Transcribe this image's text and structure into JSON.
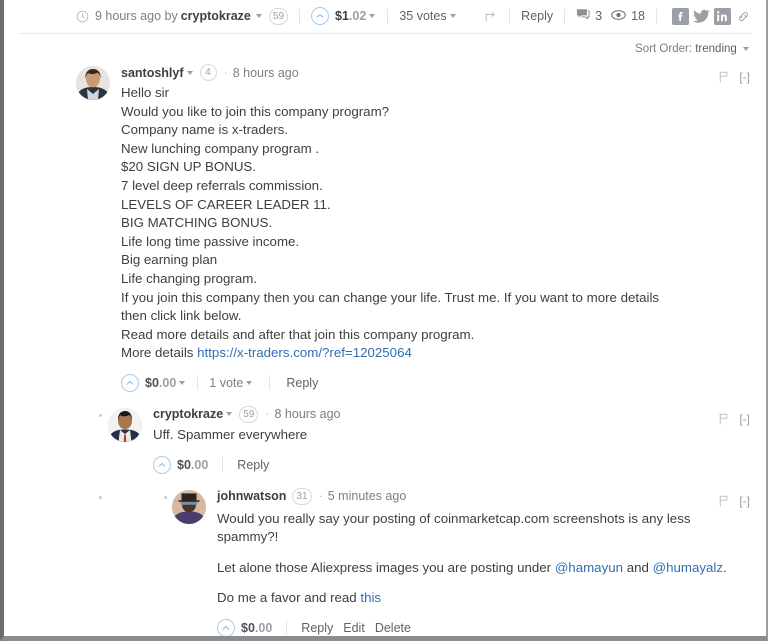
{
  "post_meta": {
    "clock_icon": "clock-icon",
    "time_prefix": "9 hours ago by",
    "author": "cryptokraze",
    "author_reputation": "59",
    "payout_dollars": "$1",
    "payout_cents": ".02",
    "votes": "35 votes",
    "share_icon": "share-icon",
    "reply_label": "Reply",
    "comment_count": "3",
    "view_count": "18",
    "social": [
      "facebook-icon",
      "twitter-icon",
      "linkedin-icon",
      "link-icon"
    ]
  },
  "sort": {
    "label": "Sort Order:",
    "value": "trending"
  },
  "comments": [
    {
      "username": "santoshlyf",
      "has_caret": true,
      "reputation": "4",
      "timestamp": "8 hours ago",
      "flag_icon": "flag-icon",
      "collapse": "[-]",
      "lines": [
        "Hello sir",
        "Would you like to join this company program?",
        "Company name is x-traders.",
        "New lunching company program .",
        "$20 SIGN UP BONUS.",
        "7 level deep referrals commission.",
        "LEVELS OF CAREER LEADER 11.",
        "BIG MATCHING BONUS.",
        "Life long time passive income.",
        "Big earning plan",
        "Life changing program.",
        "If you join this company then you can change your life. Trust me. If you want to more details then click link below.",
        "Read more details and after that join this company program."
      ],
      "more_details_prefix": "More details",
      "more_details_url": "https://x-traders.com/?ref=12025064",
      "payout_dollars": "$0",
      "payout_cents": ".00",
      "vote_label": "1 vote",
      "actions": [
        "Reply"
      ]
    },
    {
      "username": "cryptokraze",
      "has_caret": true,
      "reputation": "59",
      "timestamp": "8 hours ago",
      "flag_icon": "flag-icon",
      "collapse": "[-]",
      "text": "Uff. Spammer everywhere",
      "payout_dollars": "$0",
      "payout_cents": ".00",
      "actions": [
        "Reply"
      ]
    },
    {
      "username": "johnwatson",
      "has_caret": false,
      "reputation": "31",
      "timestamp": "5 minutes ago",
      "flag_icon": "flag-icon",
      "collapse": "[-]",
      "para1": "Would you really say your posting of coinmarketcap.com screenshots is any less spammy?!",
      "para2_before": "Let alone those Aliexpress images you are posting under ",
      "para2_mention1": "@hamayun",
      "para2_mid": " and ",
      "para2_mention2": "@humayalz",
      "para2_after": ".",
      "para3_before": "Do me a favor and read ",
      "para3_link": "this",
      "payout_dollars": "$0",
      "payout_cents": ".00",
      "actions": [
        "Reply",
        "Edit",
        "Delete"
      ]
    }
  ],
  "colors": {
    "link": "#2f6fb5",
    "text": "#3c4043",
    "muted": "#788187",
    "upvote_ring": "#a8cdf0"
  }
}
